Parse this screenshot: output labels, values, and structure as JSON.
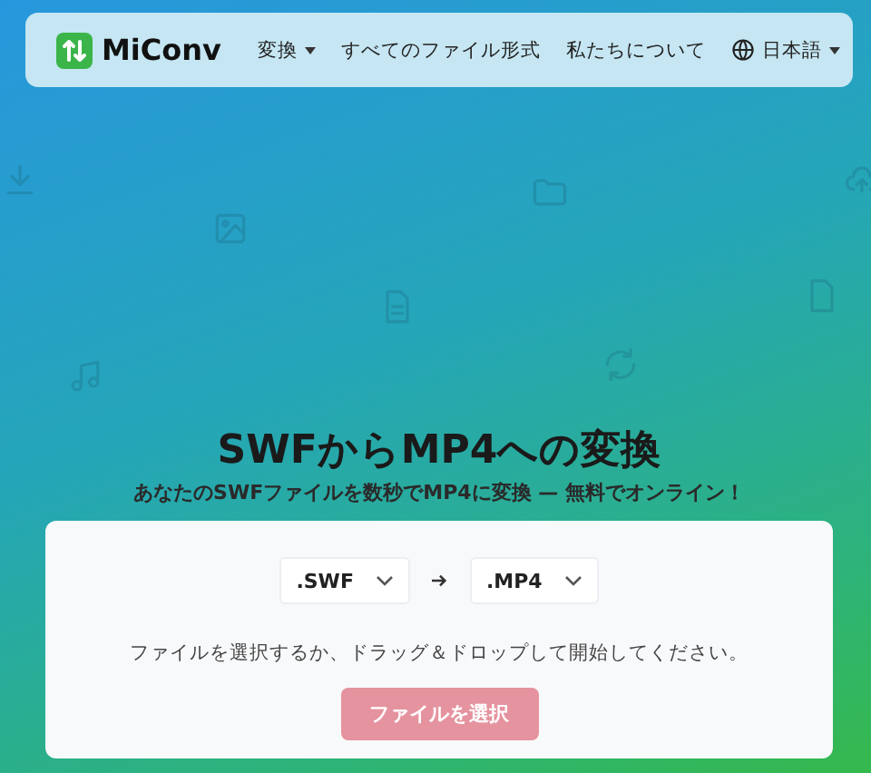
{
  "header": {
    "logo": "MiConv",
    "nav": [
      {
        "label": "変換",
        "dropdown": true
      },
      {
        "label": "すべてのファイル形式",
        "dropdown": false
      },
      {
        "label": "私たちについて",
        "dropdown": false
      }
    ],
    "language": {
      "label": "日本語"
    }
  },
  "hero": {
    "title": "SWFからMP4への変換",
    "subtitle": "あなたのSWFファイルを数秒でMP4に変換 — 無料でオンライン！"
  },
  "converter": {
    "from": ".SWF",
    "to": ".MP4",
    "instruction": "ファイルを選択するか、ドラッグ＆ドロップして開始してください。",
    "button": {
      "label": "ファイルを選択",
      "disabled": true
    }
  }
}
